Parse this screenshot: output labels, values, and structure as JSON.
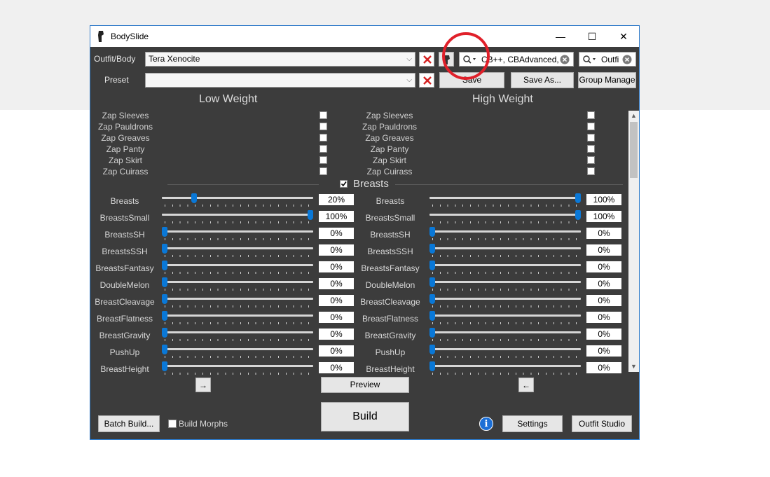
{
  "window": {
    "title": "BodySlide",
    "minimize": "—",
    "maximize": "☐",
    "close": "✕"
  },
  "outfit": {
    "label": "Outfit/Body",
    "value": "Tera Xenocite"
  },
  "preset": {
    "label": "Preset",
    "value": ""
  },
  "filter1": {
    "value": "CB++, CBAdvanced,"
  },
  "filter2": {
    "value": "Outfi"
  },
  "buttons": {
    "save": "Save",
    "save_as": "Save As...",
    "group_manage": "Group Manage",
    "preview": "Preview",
    "build": "Build",
    "batch_build": "Batch Build...",
    "settings": "Settings",
    "outfit_studio": "Outfit Studio",
    "arrow_right": "→",
    "arrow_left": "←"
  },
  "headers": {
    "low": "Low Weight",
    "high": "High Weight"
  },
  "zaps": [
    "Zap Sleeves",
    "Zap Pauldrons",
    "Zap Greaves",
    "Zap Panty",
    "Zap Skirt",
    "Zap Cuirass"
  ],
  "group": {
    "label": "Breasts",
    "checked": true
  },
  "sliders": [
    {
      "name": "Breasts",
      "low": "20%",
      "high": "100%"
    },
    {
      "name": "BreastsSmall",
      "low": "100%",
      "high": "100%"
    },
    {
      "name": "BreastsSH",
      "low": "0%",
      "high": "0%"
    },
    {
      "name": "BreastsSSH",
      "low": "0%",
      "high": "0%"
    },
    {
      "name": "BreastsFantasy",
      "low": "0%",
      "high": "0%"
    },
    {
      "name": "DoubleMelon",
      "low": "0%",
      "high": "0%"
    },
    {
      "name": "BreastCleavage",
      "low": "0%",
      "high": "0%"
    },
    {
      "name": "BreastFlatness",
      "low": "0%",
      "high": "0%"
    },
    {
      "name": "BreastGravity",
      "low": "0%",
      "high": "0%"
    },
    {
      "name": "PushUp",
      "low": "0%",
      "high": "0%"
    },
    {
      "name": "BreastHeight",
      "low": "0%",
      "high": "0%"
    }
  ],
  "build_morphs": {
    "label": "Build Morphs",
    "checked": false
  },
  "info_icon": "i"
}
